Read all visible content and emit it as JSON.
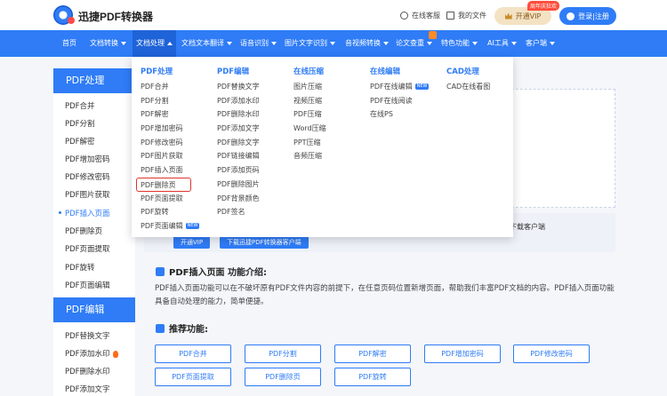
{
  "header": {
    "brand": "迅捷PDF转换器",
    "service": "在线客服",
    "my_files": "我的文件",
    "vip_label": "开通VIP",
    "vip_badge": "周年庆狂欢",
    "login_label": "登录|注册"
  },
  "nav": {
    "items": [
      "首页",
      "文档转换",
      "文档处理",
      "文档文本翻译",
      "语音识别",
      "图片文字识别",
      "音视频转换",
      "论文查重",
      "特色功能",
      "AI工具",
      "客户端"
    ]
  },
  "dropdown": {
    "columns": [
      {
        "head": "PDF处理",
        "items": [
          "PDF合并",
          "PDF分割",
          "PDF解密",
          "PDF增加密码",
          "PDF修改密码",
          "PDF图片获取",
          "PDF插入页面",
          "PDF删除页",
          "PDF页面提取",
          "PDF旋转",
          "PDF页面编辑"
        ]
      },
      {
        "head": "PDF编辑",
        "items": [
          "PDF替换文字",
          "PDF添加水印",
          "PDF删除水印",
          "PDF添加文字",
          "PDF删除文字",
          "PDF链接编辑",
          "PDF添加页码",
          "PDF删除图片",
          "PDF背景颜色",
          "PDF签名"
        ]
      },
      {
        "head": "在线压缩",
        "items": [
          "图片压缩",
          "视频压缩",
          "PDF压缩",
          "Word压缩",
          "PPT压缩",
          "音频压缩"
        ]
      },
      {
        "head": "在线编辑",
        "items": [
          "PDF在线编辑",
          "PDF在线阅读",
          "在线PS"
        ]
      },
      {
        "head": "CAD处理",
        "items": [
          "CAD在线看图"
        ]
      }
    ],
    "new_tag": "NEW"
  },
  "sidebar": {
    "head1": "PDF处理",
    "items1": [
      "PDF合并",
      "PDF分割",
      "PDF解密",
      "PDF增加密码",
      "PDF修改密码",
      "PDF图片获取",
      "PDF插入页面",
      "PDF删除页",
      "PDF页面提取",
      "PDF旋转",
      "PDF页面编辑"
    ],
    "head2": "PDF编辑",
    "items2": [
      "PDF替换文字",
      "PDF添加水印",
      "PDF删除水印",
      "PDF添加文字"
    ]
  },
  "main": {
    "info_text": "或下载客户端",
    "chip_vip": "开通VIP",
    "chip_download": "下载迅捷PDF转换器客户端",
    "intro_title": "PDF插入页面 功能介绍:",
    "intro_desc": "PDF插入页面功能可以在不破坏原有PDF文件内容的前提下，在任意页码位置新增页面，帮助我们丰富PDF文档的内容。PDF插入页面功能具备自动处理的能力，简单便捷。",
    "recommend_title": "推荐功能:",
    "recommend": [
      "PDF合并",
      "PDF分割",
      "PDF解密",
      "PDF增加密码",
      "PDF修改密码",
      "PDF页面提取",
      "PDF删除页",
      "PDF旋转"
    ]
  }
}
